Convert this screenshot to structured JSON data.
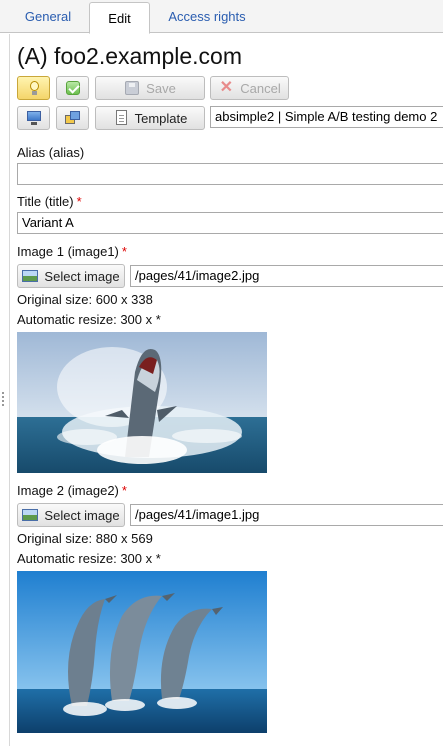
{
  "tabs": [
    {
      "label": "General"
    },
    {
      "label": "Edit"
    },
    {
      "label": "Access rights"
    }
  ],
  "page_title": "(A) foo2.example.com",
  "toolbar": {
    "save_label": "Save",
    "cancel_label": "Cancel",
    "template_label": "Template",
    "template_value": "absimple2 | Simple A/B testing demo 2"
  },
  "fields": {
    "alias": {
      "label": "Alias (alias)",
      "value": ""
    },
    "title": {
      "label": "Title (title)",
      "required": "*",
      "value": "Variant A"
    },
    "image1": {
      "label": "Image 1 (image1)",
      "required": "*",
      "select_label": "Select image",
      "path": "/pages/41/image2.jpg",
      "original_size": "Original size: 600 x 338",
      "auto_resize": "Automatic resize: 300 x *"
    },
    "image2": {
      "label": "Image 2 (image2)",
      "required": "*",
      "select_label": "Select image",
      "path": "/pages/41/image1.jpg",
      "original_size": "Original size: 880 x 569",
      "auto_resize": "Automatic resize: 300 x *"
    }
  },
  "colors": {
    "tab_link": "#2a5db0",
    "required": "#dd0000",
    "active_button": "#f4d56a"
  },
  "icons": [
    "lightbulb-icon",
    "checkmark-icon",
    "disk-icon",
    "x-icon",
    "monitor-icon",
    "windows-icon",
    "document-icon",
    "image-icon"
  ]
}
